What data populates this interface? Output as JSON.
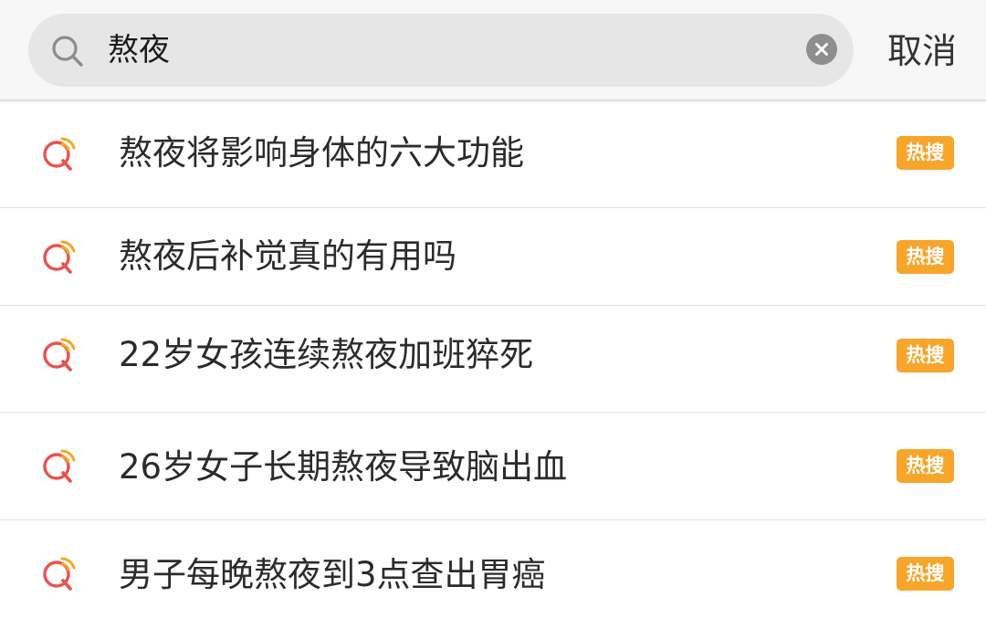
{
  "search": {
    "query": "熬夜",
    "cancel_label": "取消"
  },
  "suggestions": [
    {
      "text": "熬夜将影响身体的六大功能",
      "badge": "热搜"
    },
    {
      "text": "熬夜后补觉真的有用吗",
      "badge": "热搜"
    },
    {
      "text": "22岁女孩连续熬夜加班猝死",
      "badge": "热搜"
    },
    {
      "text": "26岁女子长期熬夜导致脑出血",
      "badge": "热搜"
    },
    {
      "text": "男子每晚熬夜到3点查出胃癌",
      "badge": "热搜"
    }
  ],
  "colors": {
    "badge_bg": "#f7a52b",
    "suggestion_icon_red": "#e8534f",
    "suggestion_icon_orange": "#f5a623"
  },
  "icons": {
    "search": "search-icon",
    "clear": "clear-icon",
    "suggestion": "hot-search-suggestion-icon"
  }
}
